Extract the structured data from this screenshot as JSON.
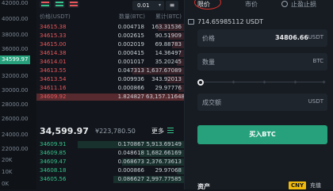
{
  "axis": {
    "labels": [
      "42000.00",
      "40000.00",
      "38000.00",
      "36000.00",
      "34599.97",
      "32000.00",
      "30000.00",
      "28000.00",
      "26000.00",
      "24000.00",
      "22000.00",
      "20K",
      "10K",
      "0K"
    ],
    "current": "34599.97"
  },
  "toolbar": {
    "precision": "0.01",
    "caret": "▾",
    "settings_icon": "≡"
  },
  "orderbook_header": {
    "price": "价格(USDT)",
    "qty": "数量(BTC)",
    "total": "累计(BTC)"
  },
  "asks": [
    {
      "price": "34615.38",
      "qty": "0.004718",
      "total": "163.31536",
      "depth": 0.18
    },
    {
      "price": "34615.33",
      "qty": "0.002615",
      "total": "90.51909",
      "depth": 0.1
    },
    {
      "price": "34615.00",
      "qty": "0.002019",
      "total": "69.88783",
      "depth": 0.08
    },
    {
      "price": "34614.38",
      "qty": "0.000415",
      "total": "14.36497",
      "depth": 0.03
    },
    {
      "price": "34614.01",
      "qty": "0.001017",
      "total": "35.20245",
      "depth": 0.05
    },
    {
      "price": "34613.55",
      "qty": "0.047313",
      "total": "1,637.67089",
      "depth": 0.35
    },
    {
      "price": "34613.54",
      "qty": "0.009936",
      "total": "343.92013",
      "depth": 0.12
    },
    {
      "price": "34611.16",
      "qty": "0.000866",
      "total": "29.97776",
      "depth": 0.04
    },
    {
      "price": "34609.92",
      "qty": "1.824827",
      "total": "63,157.11648",
      "depth": 1.0,
      "highlight": true
    }
  ],
  "mid": {
    "price": "34,599.97",
    "usd": "¥223,780.50",
    "more": "更多"
  },
  "bids": [
    {
      "price": "34609.91",
      "qty": "0.170867",
      "total": "5,913.69149",
      "depth": 0.72
    },
    {
      "price": "34609.85",
      "qty": "0.048618",
      "total": "1,682.66169",
      "depth": 0.3
    },
    {
      "price": "34609.47",
      "qty": "0.068673",
      "total": "2,376.73613",
      "depth": 0.42
    },
    {
      "price": "34608.18",
      "qty": "0.000866",
      "total": "29.97068",
      "depth": 0.05
    },
    {
      "price": "34605.56",
      "qty": "0.086627",
      "total": "2,997.77585",
      "depth": 0.48
    }
  ],
  "trade": {
    "tab_limit": "限价",
    "tab_market": "市价",
    "tab_stop": "止盈止损",
    "balance": "714.65985112 USDT",
    "price_label": "价格",
    "price_value": "34806.66",
    "price_unit": "USDT",
    "qty_label": "数量",
    "qty_unit": "BTC",
    "total_label": "成交额",
    "total_unit": "USDT",
    "buy_label": "买入BTC",
    "assets_label": "资产",
    "cny_badge": "CNY",
    "cny_text": "充值"
  }
}
